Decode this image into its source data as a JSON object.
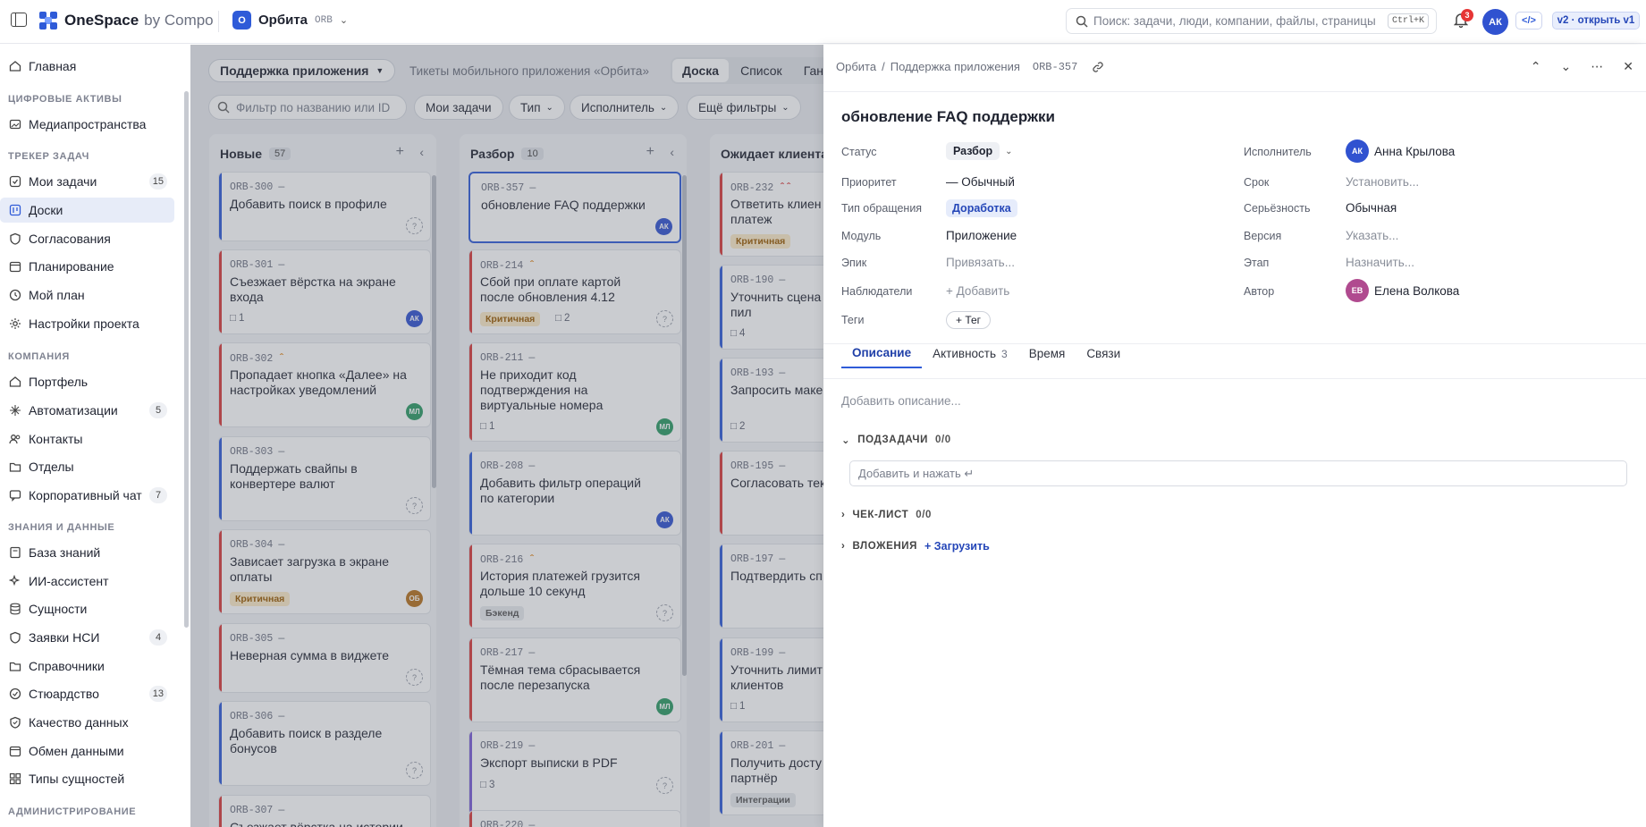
{
  "app": {
    "name": "OneSpace",
    "by": "by Compo"
  },
  "project": {
    "badge": "О",
    "name": "Орбита",
    "code": "ORB"
  },
  "search": {
    "placeholder": "Поиск: задачи, люди, компании, файлы, страницы",
    "shortcut": "Ctrl+K"
  },
  "notifications": {
    "count": "3"
  },
  "user": {
    "initials": "АК"
  },
  "header_buttons": {
    "code": "</>",
    "version": "v2 · открыть v1"
  },
  "sidebar": {
    "home": "Главная",
    "sections": {
      "digital": "ЦИФРОВЫЕ АКТИВЫ",
      "tracker": "ТРЕКЕР ЗАДАЧ",
      "company": "КОМПАНИЯ",
      "knowledge": "ЗНАНИЯ И ДАННЫЕ",
      "admin": "АДМИНИСТРИРОВАНИЕ"
    },
    "items": [
      {
        "label": "Медиапространства"
      },
      {
        "label": "Мои задачи",
        "count": "15"
      },
      {
        "label": "Доски"
      },
      {
        "label": "Согласования"
      },
      {
        "label": "Планирование"
      },
      {
        "label": "Мой план"
      },
      {
        "label": "Настройки проекта"
      },
      {
        "label": "Портфель"
      },
      {
        "label": "Автоматизации",
        "count": "5"
      },
      {
        "label": "Контакты"
      },
      {
        "label": "Отделы"
      },
      {
        "label": "Корпоративный чат",
        "count": "7"
      },
      {
        "label": "База знаний"
      },
      {
        "label": "ИИ-ассистент"
      },
      {
        "label": "Сущности"
      },
      {
        "label": "Заявки НСИ",
        "count": "4"
      },
      {
        "label": "Справочники"
      },
      {
        "label": "Стюардство",
        "count": "13"
      },
      {
        "label": "Качество данных"
      },
      {
        "label": "Обмен данными"
      },
      {
        "label": "Типы сущностей"
      }
    ]
  },
  "board": {
    "selector": "Поддержка приложения",
    "subtitle": "Тикеты мобильного приложения «Орбита»",
    "views": [
      "Доска",
      "Список",
      "Ган"
    ],
    "filter_placeholder": "Фильтр по названию или ID",
    "chips": [
      "Мои задачи",
      "Тип",
      "Исполнитель",
      "Ещё фильтры"
    ],
    "columns": [
      {
        "title": "Новые",
        "count": "57",
        "cards": [
          {
            "id": "ORB-300",
            "title": "Добавить поиск в профиле"
          },
          {
            "id": "ORB-301",
            "title": "Съезжает вёрстка на экране входа",
            "comments": "1",
            "assignee": "АК"
          },
          {
            "id": "ORB-302",
            "title": "Пропадает кнопка «Далее» на настройках уведомлений",
            "assignee": "МЛ"
          },
          {
            "id": "ORB-303",
            "title": "Поддержать свайпы в конвертере валют"
          },
          {
            "id": "ORB-304",
            "title": "Зависает загрузка в экране оплаты",
            "tag": "Критичная",
            "assignee": "ОБ"
          },
          {
            "id": "ORB-305",
            "title": "Неверная сумма в виджете"
          },
          {
            "id": "ORB-306",
            "title": "Добавить поиск в разделе бонусов"
          },
          {
            "id": "ORB-307",
            "title": "Съезжает вёрстка на истории"
          }
        ]
      },
      {
        "title": "Разбор",
        "count": "10",
        "cards": [
          {
            "id": "ORB-357",
            "title": "обновление FAQ поддержки",
            "assignee": "АК"
          },
          {
            "id": "ORB-214",
            "title": "Сбой при оплате картой после обновления 4.12",
            "tag": "Критичная",
            "comments": "2"
          },
          {
            "id": "ORB-211",
            "title": "Не приходит код подтверждения на виртуальные номера",
            "comments": "1",
            "assignee": "МЛ"
          },
          {
            "id": "ORB-208",
            "title": "Добавить фильтр операций по категории",
            "assignee": "АК"
          },
          {
            "id": "ORB-216",
            "title": "История платежей грузится дольше 10 секунд",
            "tag": "Бэкенд"
          },
          {
            "id": "ORB-217",
            "title": "Тёмная тема сбрасывается после перезапуска",
            "assignee": "МЛ"
          },
          {
            "id": "ORB-219",
            "title": "Экспорт выписки в PDF",
            "comments": "3"
          },
          {
            "id": "ORB-220",
            "title": ""
          }
        ]
      },
      {
        "title": "Ожидает клиента",
        "cards": [
          {
            "id": "ORB-232",
            "title": "Ответить клиен возврата платеж",
            "tag": "Критичная"
          },
          {
            "id": "ORB-190",
            "title": "Уточнить сцена подписки у пил",
            "comments": "4"
          },
          {
            "id": "ORB-193",
            "title": "Запросить маке бонусов",
            "comments": "2"
          },
          {
            "id": "ORB-195",
            "title": "Согласовать тек продлении"
          },
          {
            "id": "ORB-197",
            "title": "Подтвердить сп конвертера"
          },
          {
            "id": "ORB-199",
            "title": "Уточнить лимит новых клиентов",
            "comments": "1"
          },
          {
            "id": "ORB-201",
            "title": "Получить досту контуру партнёр",
            "tag": "Интеграции"
          }
        ]
      }
    ]
  },
  "panel": {
    "breadcrumb": [
      "Орбита",
      "Поддержка приложения"
    ],
    "ticket_id": "ORB-357",
    "title": "обновление FAQ поддержки",
    "fields": {
      "status": {
        "label": "Статус",
        "value": "Разбор"
      },
      "priority": {
        "label": "Приоритет",
        "value": "— Обычный"
      },
      "type": {
        "label": "Тип обращения",
        "value": "Доработка"
      },
      "module": {
        "label": "Модуль",
        "value": "Приложение"
      },
      "epic": {
        "label": "Эпик",
        "value": "Привязать..."
      },
      "watchers": {
        "label": "Наблюдатели",
        "value": "+ Добавить"
      },
      "tags": {
        "label": "Теги",
        "value": "+ Тег"
      },
      "assignee": {
        "label": "Исполнитель",
        "value": "Анна Крылова",
        "initials": "АК"
      },
      "due": {
        "label": "Срок",
        "value": "Установить..."
      },
      "severity": {
        "label": "Серьёзность",
        "value": "Обычная"
      },
      "version": {
        "label": "Версия",
        "value": "Указать..."
      },
      "stage": {
        "label": "Этап",
        "value": "Назначить..."
      },
      "author": {
        "label": "Автор",
        "value": "Елена Волкова",
        "initials": "ЕВ"
      }
    },
    "tabs": [
      {
        "label": "Описание"
      },
      {
        "label": "Активность",
        "count": "3"
      },
      {
        "label": "Время"
      },
      {
        "label": "Связи"
      }
    ],
    "description_placeholder": "Добавить описание...",
    "subtasks": {
      "label": "ПОДЗАДАЧИ",
      "count": "0/0",
      "input_placeholder": "Добавить и нажать ↵"
    },
    "checklist": {
      "label": "ЧЕК-ЛИСТ",
      "count": "0/0"
    },
    "attachments": {
      "label": "ВЛОЖЕНИЯ",
      "upload": "+ Загрузить"
    }
  },
  "colors": {
    "accent": "#2f5bd8",
    "critical": "#d73a3a",
    "priority_up": "#e0861d"
  }
}
